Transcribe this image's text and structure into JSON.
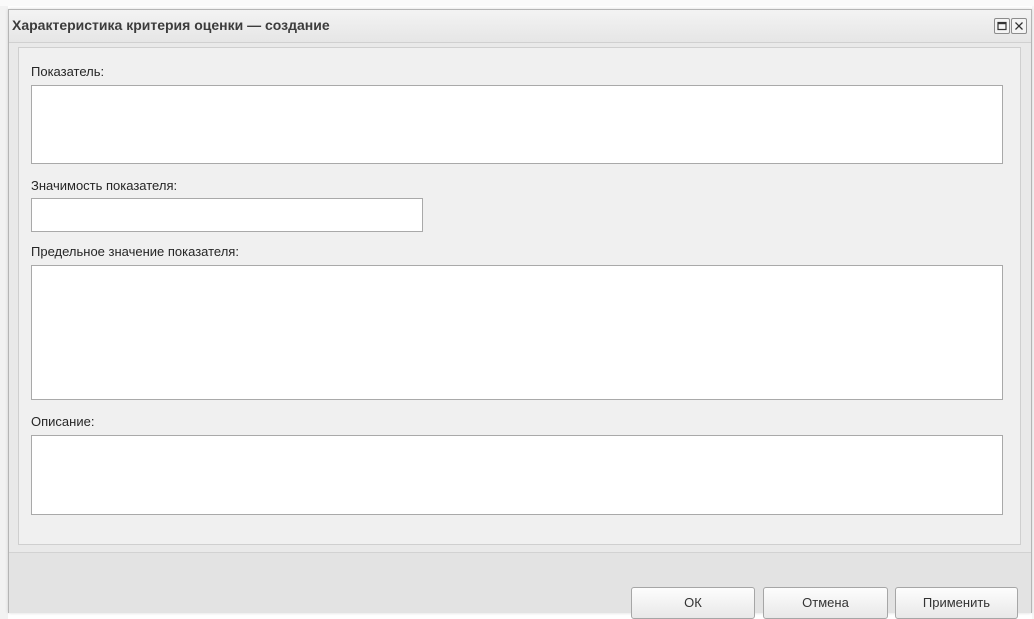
{
  "dialog": {
    "title": "Характеристика критерия оценки — создание",
    "icons": {
      "maximize": "maximize-icon",
      "close": "close-icon"
    }
  },
  "form": {
    "indicator": {
      "label": "Показатель:",
      "value": ""
    },
    "significance": {
      "label": "Значимость показателя:",
      "value": ""
    },
    "limit_value": {
      "label": "Предельное значение показателя:",
      "value": ""
    },
    "description": {
      "label": "Описание:",
      "value": ""
    }
  },
  "buttons": {
    "ok": "ОК",
    "cancel": "Отмена",
    "apply": "Применить"
  },
  "colors": {
    "dialog_background": "#e9e9e9",
    "panel_background": "#f0f0f0",
    "input_border": "#a9a9a9",
    "title_text": "#3c3c3c"
  }
}
